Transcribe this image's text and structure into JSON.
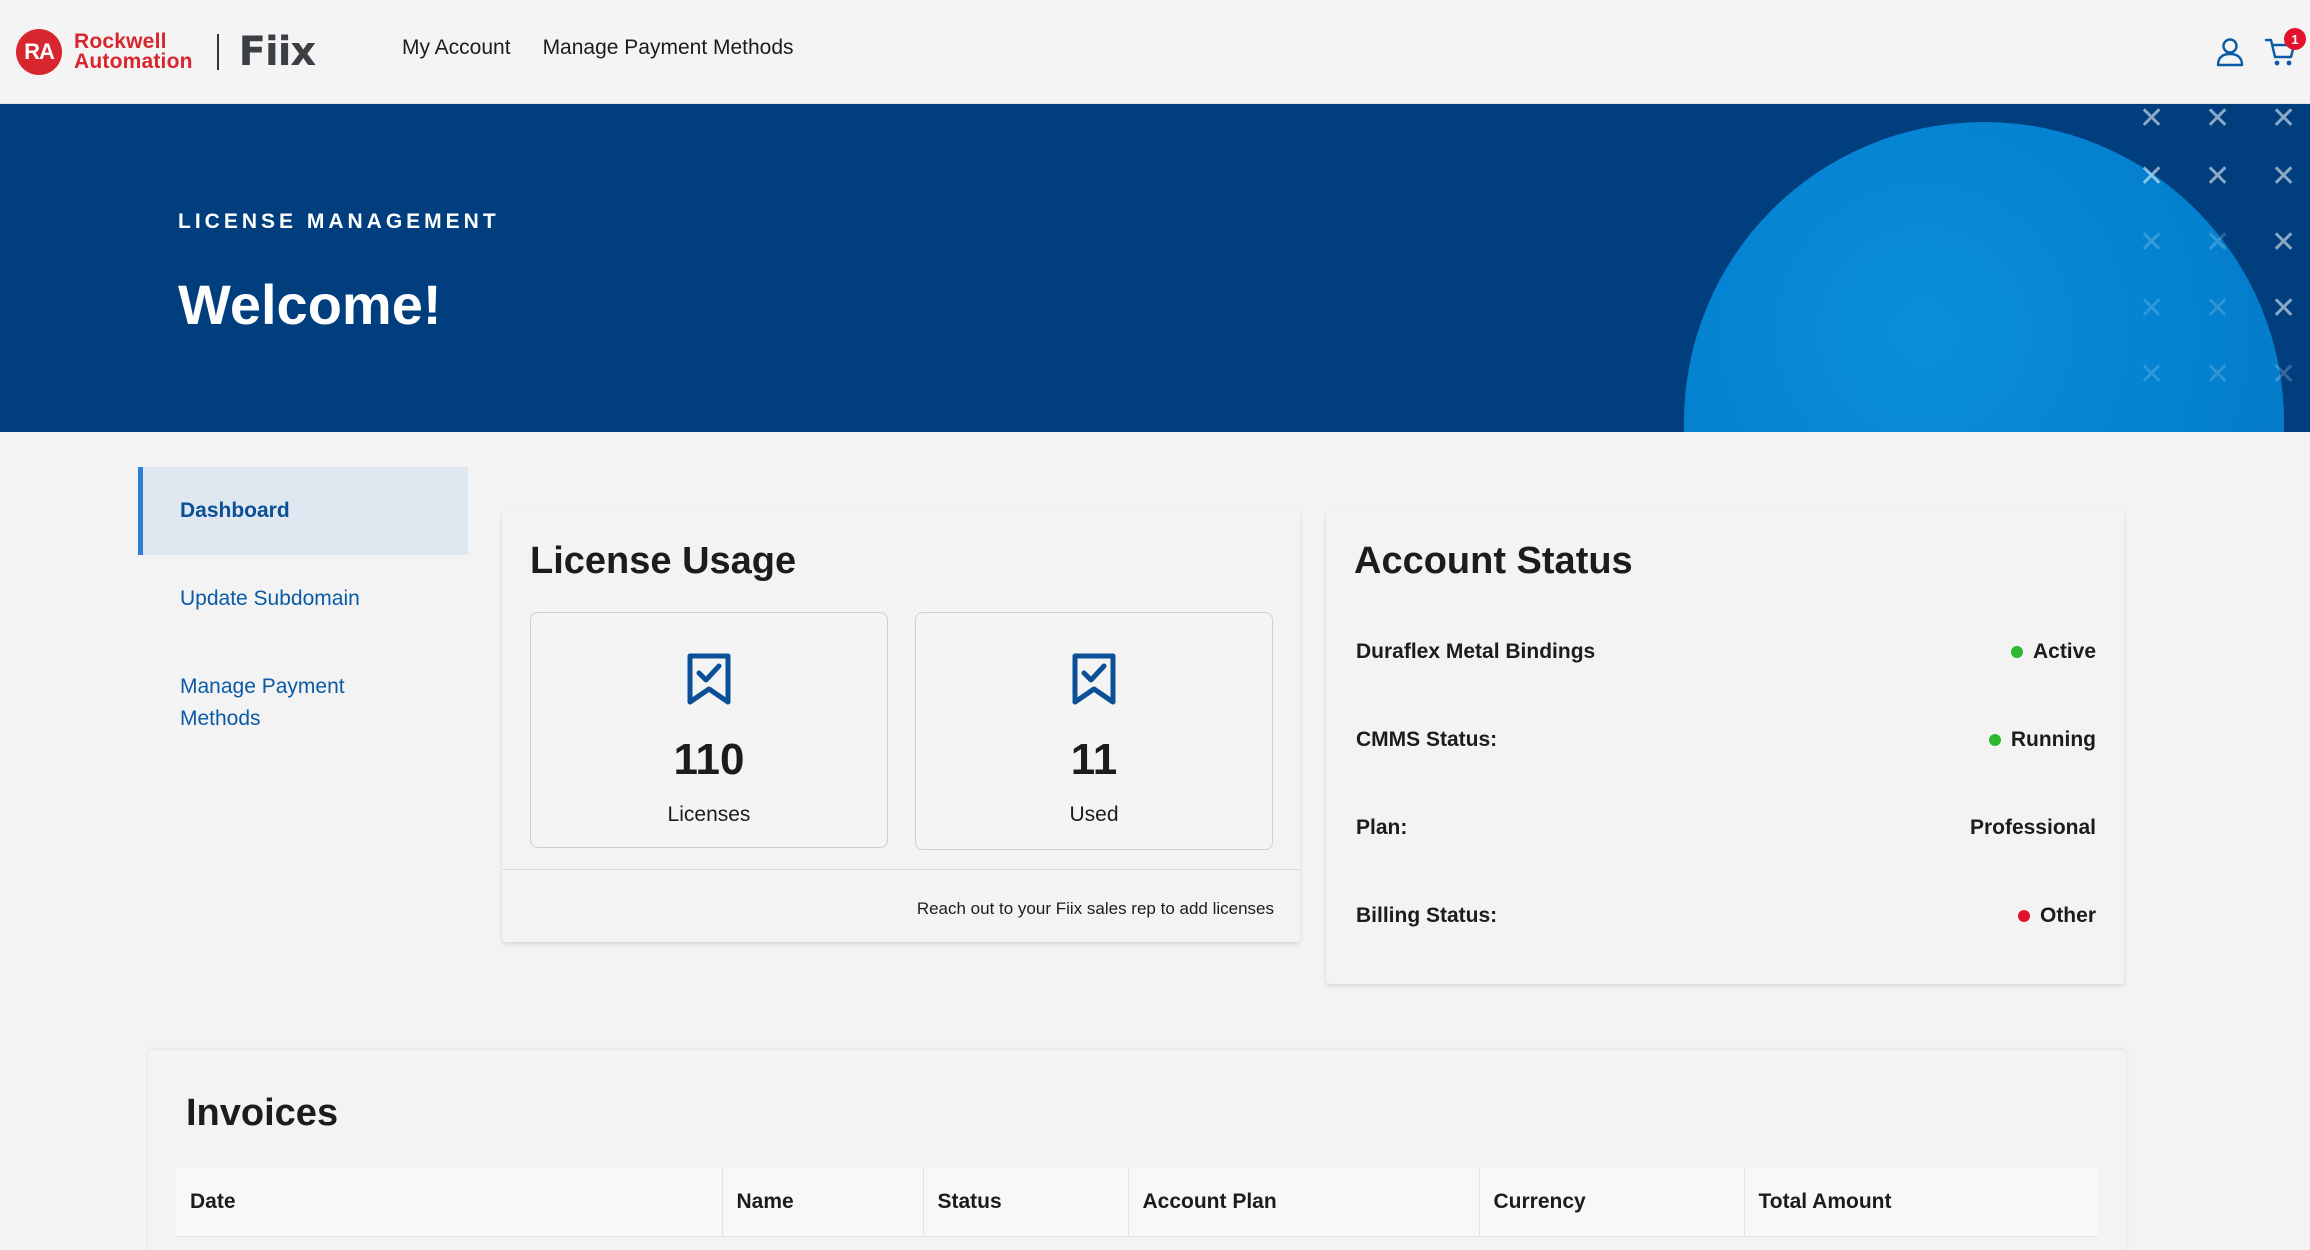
{
  "brand": {
    "ra_badge": "RA",
    "ra_line1": "Rockwell",
    "ra_line2": "Automation",
    "fiix": "Fiix"
  },
  "topnav": {
    "items": [
      "My Account",
      "Manage Payment Methods"
    ],
    "cart_count": "1"
  },
  "hero": {
    "kicker": "LICENSE MANAGEMENT",
    "title": "Welcome!"
  },
  "sidebar": {
    "items": [
      {
        "label": "Dashboard",
        "active": true
      },
      {
        "label": "Update Subdomain",
        "active": false
      },
      {
        "label": "Manage Payment Methods",
        "active": false
      }
    ]
  },
  "license_usage": {
    "title": "License Usage",
    "stats": [
      {
        "value": "110",
        "label": "Licenses"
      },
      {
        "value": "11",
        "label": "Used"
      }
    ],
    "note": "Reach out to your Fiix sales rep to add licenses"
  },
  "account_status": {
    "title": "Account Status",
    "rows": [
      {
        "label": "Duraflex Metal Bindings",
        "value": "Active",
        "dot": "#2eb82e"
      },
      {
        "label": "CMMS Status:",
        "value": "Running",
        "dot": "#2eb82e"
      },
      {
        "label": "Plan:",
        "value": "Professional",
        "dot": ""
      },
      {
        "label": "Billing Status:",
        "value": "Other",
        "dot": "#e4112d"
      }
    ]
  },
  "invoices": {
    "title": "Invoices",
    "columns": [
      "Date",
      "Name",
      "Status",
      "Account Plan",
      "Currency",
      "Total Amount"
    ]
  },
  "colors": {
    "hero_bg": "#003e7e",
    "accent_blue": "#0a5aa5",
    "brand_red": "#d8262e"
  }
}
